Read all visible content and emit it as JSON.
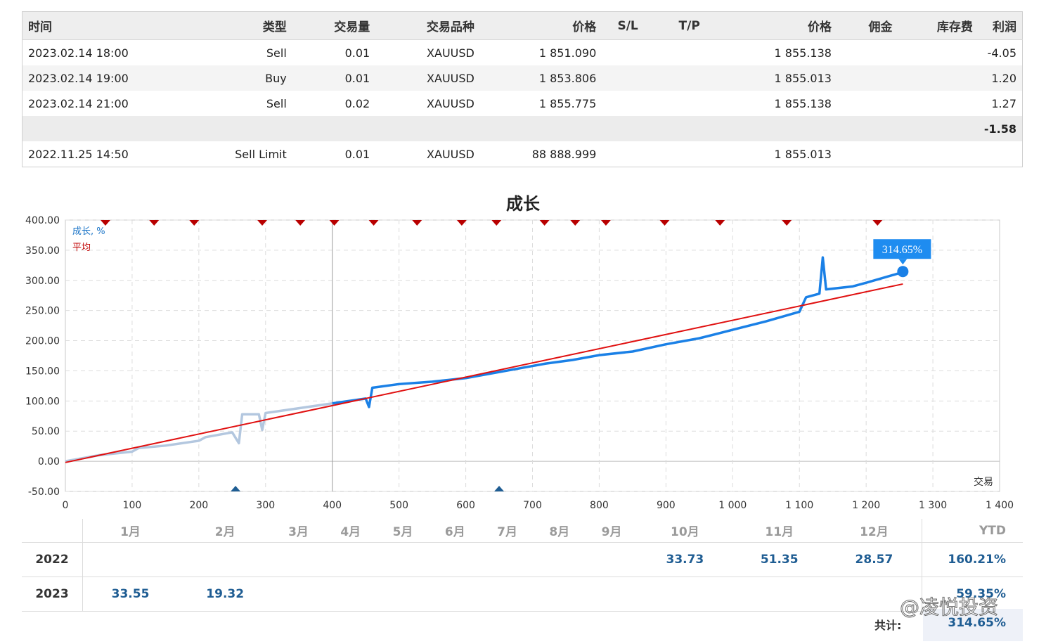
{
  "trades": {
    "headers": [
      "时间",
      "类型",
      "交易量",
      "交易品种",
      "价格",
      "S/L",
      "T/P",
      "价格",
      "佣金",
      "库存费",
      "利润"
    ],
    "rows": [
      {
        "time": "2023.02.14 18:00",
        "type": "Sell",
        "volume": "0.01",
        "symbol": "XAUUSD",
        "price": "1 851.090",
        "sl": "",
        "tp": "",
        "price2": "1 855.138",
        "commission": "",
        "swap": "",
        "profit": "-4.05"
      },
      {
        "time": "2023.02.14 19:00",
        "type": "Buy",
        "volume": "0.01",
        "symbol": "XAUUSD",
        "price": "1 853.806",
        "sl": "",
        "tp": "",
        "price2": "1 855.013",
        "commission": "",
        "swap": "",
        "profit": "1.20"
      },
      {
        "time": "2023.02.14 21:00",
        "type": "Sell",
        "volume": "0.02",
        "symbol": "XAUUSD",
        "price": "1 855.775",
        "sl": "",
        "tp": "",
        "price2": "1 855.138",
        "commission": "",
        "swap": "",
        "profit": "1.27"
      }
    ],
    "total_profit": "-1.58",
    "pending": {
      "time": "2022.11.25 14:50",
      "type": "Sell Limit",
      "volume": "0.01",
      "symbol": "XAUUSD",
      "price": "88 888.999",
      "price2": "1 855.013"
    }
  },
  "chart_data": {
    "type": "line",
    "title": "成长",
    "xlabel": "交易",
    "ylabel": "",
    "legend": [
      "成长, %",
      "平均"
    ],
    "legend_placement": "top-left",
    "xlim": [
      0,
      1400
    ],
    "ylim": [
      -50,
      400
    ],
    "xticks": [
      "0",
      "100",
      "200",
      "300",
      "400",
      "500",
      "600",
      "700",
      "800",
      "900",
      "1 000",
      "1 100",
      "1 200",
      "1 300",
      "1 400"
    ],
    "yticks": [
      "400.00",
      "350.00",
      "300.00",
      "250.00",
      "200.00",
      "150.00",
      "100.00",
      "50.00",
      "0.00",
      "-50.00"
    ],
    "grid": true,
    "series": [
      {
        "name": "成长, %",
        "color": "#1a80e6",
        "x": [
          0,
          20,
          50,
          100,
          110,
          150,
          200,
          210,
          250,
          260,
          265,
          290,
          295,
          300,
          350,
          400,
          450,
          455,
          460,
          500,
          550,
          600,
          650,
          700,
          720,
          760,
          800,
          850,
          900,
          950,
          1000,
          1050,
          1100,
          1110,
          1130,
          1135,
          1140,
          1180,
          1200,
          1250,
          1255
        ],
        "y": [
          0,
          4,
          10,
          16,
          22,
          26,
          34,
          40,
          48,
          30,
          78,
          78,
          52,
          80,
          88,
          96,
          104,
          90,
          122,
          128,
          132,
          138,
          148,
          158,
          162,
          168,
          176,
          182,
          194,
          204,
          218,
          232,
          248,
          272,
          278,
          338,
          285,
          290,
          296,
          312,
          314.65
        ]
      },
      {
        "name": "平均",
        "color": "#e01010",
        "x": [
          0,
          1255
        ],
        "y": [
          -2,
          294
        ]
      }
    ],
    "callout": "314.65%",
    "top_markers_x": [
      60,
      133,
      193,
      295,
      352,
      403,
      462,
      527,
      594,
      646,
      718,
      764,
      810,
      898,
      981,
      1081,
      1217
    ],
    "bottom_markers_x": [
      255,
      650
    ]
  },
  "monthly": {
    "months": [
      "1月",
      "2月",
      "3月",
      "4月",
      "5月",
      "6月",
      "7月",
      "8月",
      "9月",
      "10月",
      "11月",
      "12月"
    ],
    "ytd_header": "YTD",
    "rows": [
      {
        "year": "2022",
        "values": [
          "",
          "",
          "",
          "",
          "",
          "",
          "",
          "",
          "",
          "33.73",
          "51.35",
          "28.57"
        ],
        "ytd": "160.21%"
      },
      {
        "year": "2023",
        "values": [
          "33.55",
          "19.32",
          "",
          "",
          "",
          "",
          "",
          "",
          "",
          "",
          "",
          ""
        ],
        "ytd": "59.35%"
      }
    ],
    "total_label": "共计:",
    "total_value": "314.65%"
  },
  "watermark": "@凌悦投资"
}
